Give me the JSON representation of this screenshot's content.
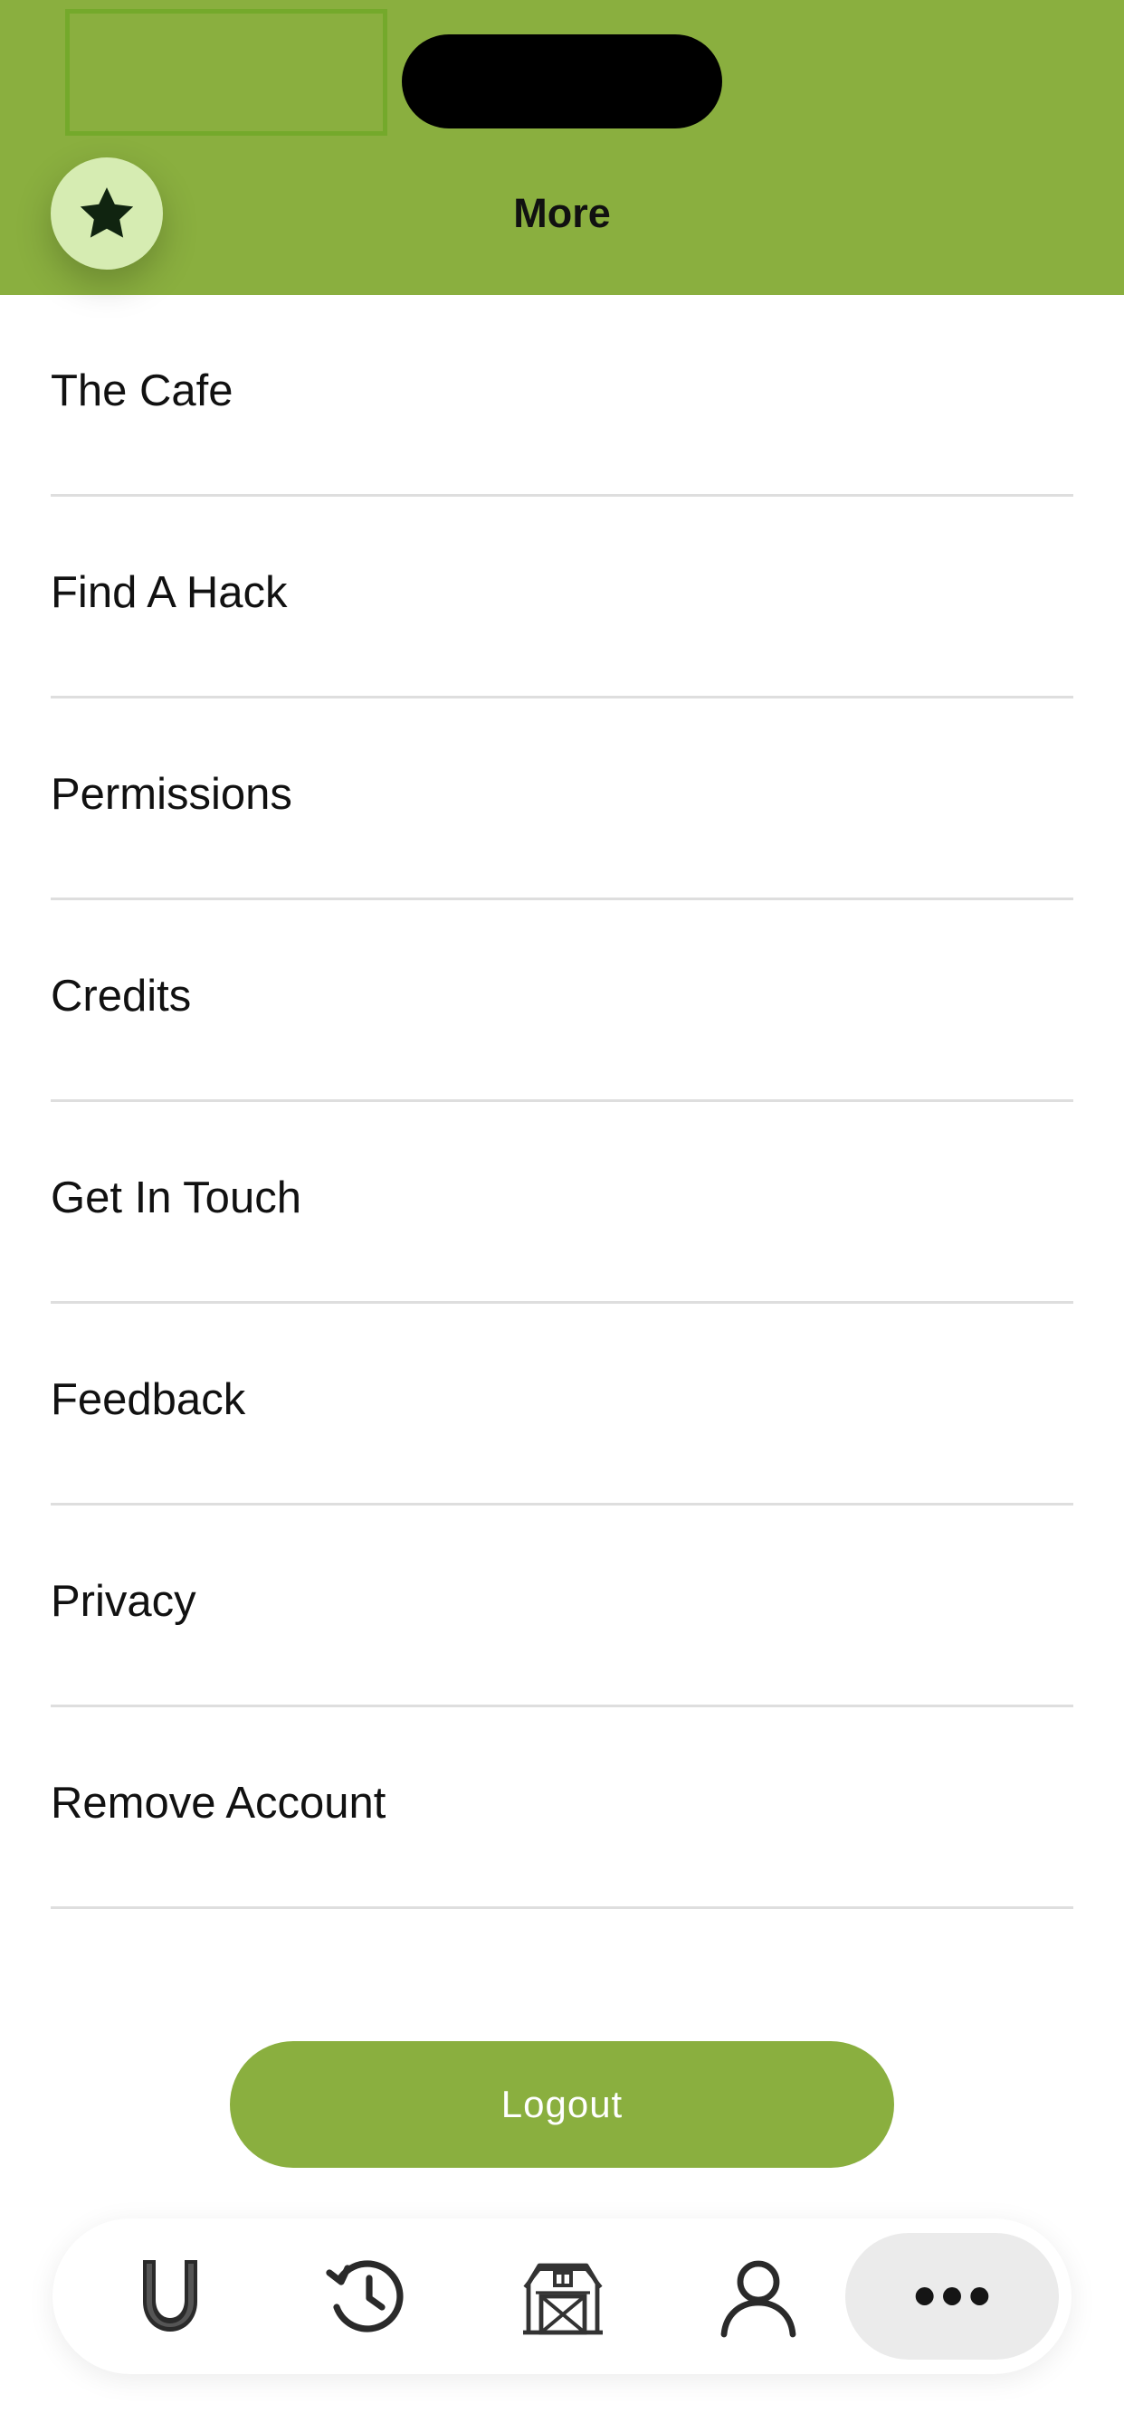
{
  "header": {
    "title": "More",
    "background_color": "#8aaf3f"
  },
  "favorite_button": {
    "icon": "star-icon"
  },
  "menu": {
    "items": [
      {
        "label": "The Cafe"
      },
      {
        "label": "Find A Hack"
      },
      {
        "label": "Permissions"
      },
      {
        "label": "Credits"
      },
      {
        "label": "Get In Touch"
      },
      {
        "label": "Feedback"
      },
      {
        "label": "Privacy"
      },
      {
        "label": "Remove Account"
      }
    ]
  },
  "logout": {
    "label": "Logout"
  },
  "tabbar": {
    "tabs": [
      {
        "icon": "horseshoe-icon",
        "active": false
      },
      {
        "icon": "history-icon",
        "active": false
      },
      {
        "icon": "barn-icon",
        "active": false
      },
      {
        "icon": "profile-icon",
        "active": false
      },
      {
        "icon": "more-dots-icon",
        "active": true
      }
    ]
  }
}
